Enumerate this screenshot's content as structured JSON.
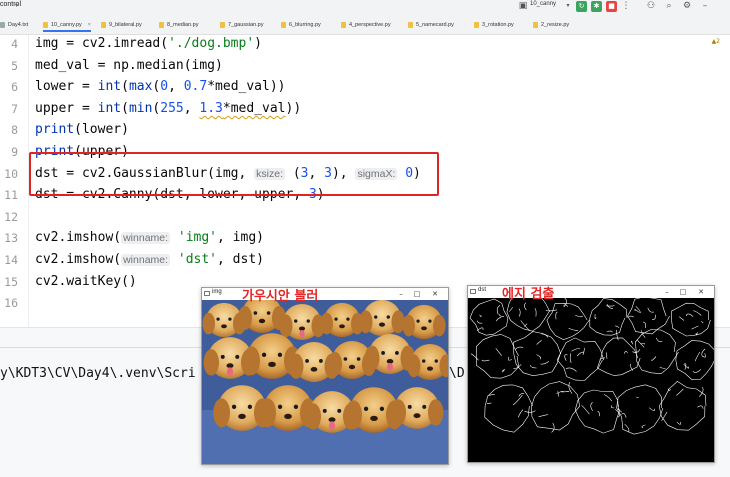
{
  "toolbar": {
    "project_label": "control",
    "run_config": "10_canny",
    "colors": {
      "run": "#3ba55d",
      "debug": "#3ba55d",
      "stop": "#e64545"
    }
  },
  "tabs": [
    {
      "label": "Day4.txt",
      "icon": "text-file-icon",
      "active": false
    },
    {
      "label": "10_canny.py",
      "icon": "python-file-icon",
      "active": true
    },
    {
      "label": "9_bilateral.py",
      "icon": "python-file-icon",
      "active": false
    },
    {
      "label": "8_median.py",
      "icon": "python-file-icon",
      "active": false
    },
    {
      "label": "7_gaussian.py",
      "icon": "python-file-icon",
      "active": false
    },
    {
      "label": "6_blurring.py",
      "icon": "python-file-icon",
      "active": false
    },
    {
      "label": "4_perspective.py",
      "icon": "python-file-icon",
      "active": false
    },
    {
      "label": "5_namecard.py",
      "icon": "python-file-icon",
      "active": false
    },
    {
      "label": "3_rotation.py",
      "icon": "python-file-icon",
      "active": false
    },
    {
      "label": "2_resize.py",
      "icon": "python-file-icon",
      "active": false
    }
  ],
  "editor": {
    "warnings": "▲2",
    "lines": [
      {
        "n": "4",
        "code": "img = cv2.imread('./dog.bmp')"
      },
      {
        "n": "5",
        "code": "med_val = np.median(img)"
      },
      {
        "n": "6",
        "code": "lower = int(max(0, 0.7*med_val))"
      },
      {
        "n": "7",
        "code": "upper = int(min(255, 1.3*med_val))"
      },
      {
        "n": "8",
        "code": "print(lower)"
      },
      {
        "n": "9",
        "code": "print(upper)"
      },
      {
        "n": "10",
        "code": "dst = cv2.GaussianBlur(img, ksize: (3, 3), sigmaX: 0)"
      },
      {
        "n": "11",
        "code": "dst = cv2.Canny(dst, lower, upper, 3)"
      },
      {
        "n": "12",
        "code": ""
      },
      {
        "n": "13",
        "code": "cv2.imshow(winname: 'img', img)"
      },
      {
        "n": "14",
        "code": "cv2.imshow(winname: 'dst', dst)"
      },
      {
        "n": "15",
        "code": "cv2.waitKey()"
      },
      {
        "n": "16",
        "code": ""
      }
    ],
    "hints": {
      "ksize": "ksize:",
      "sigmaX": "sigmaX:",
      "winname": "winname:"
    }
  },
  "terminal": {
    "path_left": "y\\KDT3\\CV\\Day4\\.venv\\Scri",
    "path_right": "\\D"
  },
  "windows": {
    "img": {
      "title": "img",
      "overlay": "가우시안 블러"
    },
    "dst": {
      "title": "dst",
      "overlay": "에지 검출"
    }
  }
}
